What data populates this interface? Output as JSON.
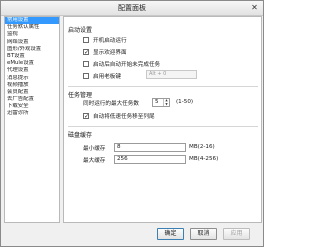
{
  "window": {
    "title": "配置面板",
    "close_glyph": "✕"
  },
  "nav": {
    "items": [
      {
        "label": "常用设置",
        "selected": true
      },
      {
        "label": "任务默认属性",
        "selected": false
      },
      {
        "label": "监视",
        "selected": false
      },
      {
        "label": "网络设置",
        "selected": false
      },
      {
        "label": "图形/外观设置",
        "selected": false
      },
      {
        "label": "BT设置",
        "selected": false
      },
      {
        "label": "eMule设置",
        "selected": false
      },
      {
        "label": "代理设置",
        "selected": false
      },
      {
        "label": "消息提示",
        "selected": false
      },
      {
        "label": "视频播放",
        "selected": false
      },
      {
        "label": "会员配置",
        "selected": false
      },
      {
        "label": "去广告配置",
        "selected": false
      },
      {
        "label": "下载安全",
        "selected": false
      },
      {
        "label": "迅雷诊所",
        "selected": false
      }
    ]
  },
  "startup": {
    "title": "启动设置",
    "options": [
      {
        "label": "开机启动运行",
        "checked": false
      },
      {
        "label": "显示欢迎界面",
        "checked": true
      },
      {
        "label": "启动后自动开始未完成任务",
        "checked": false
      }
    ],
    "boss_key": {
      "label": "启用老板键",
      "checked": false,
      "value": "Alt + 0"
    }
  },
  "task": {
    "title": "任务管理",
    "max_tasks_label": "同时运行的最大任务数",
    "max_tasks_value": "5",
    "max_tasks_range": "(1-50)",
    "auto_move": {
      "label": "自动将低速任务移至列尾",
      "checked": true
    }
  },
  "disk": {
    "title": "磁盘缓存",
    "min_label": "最小缓存",
    "min_value": "8",
    "min_range": "MB(2-16)",
    "max_label": "最大缓存",
    "max_value": "256",
    "max_range": "MB(4-256)"
  },
  "buttons": {
    "ok": "确定",
    "cancel": "取消",
    "apply": "应用"
  }
}
